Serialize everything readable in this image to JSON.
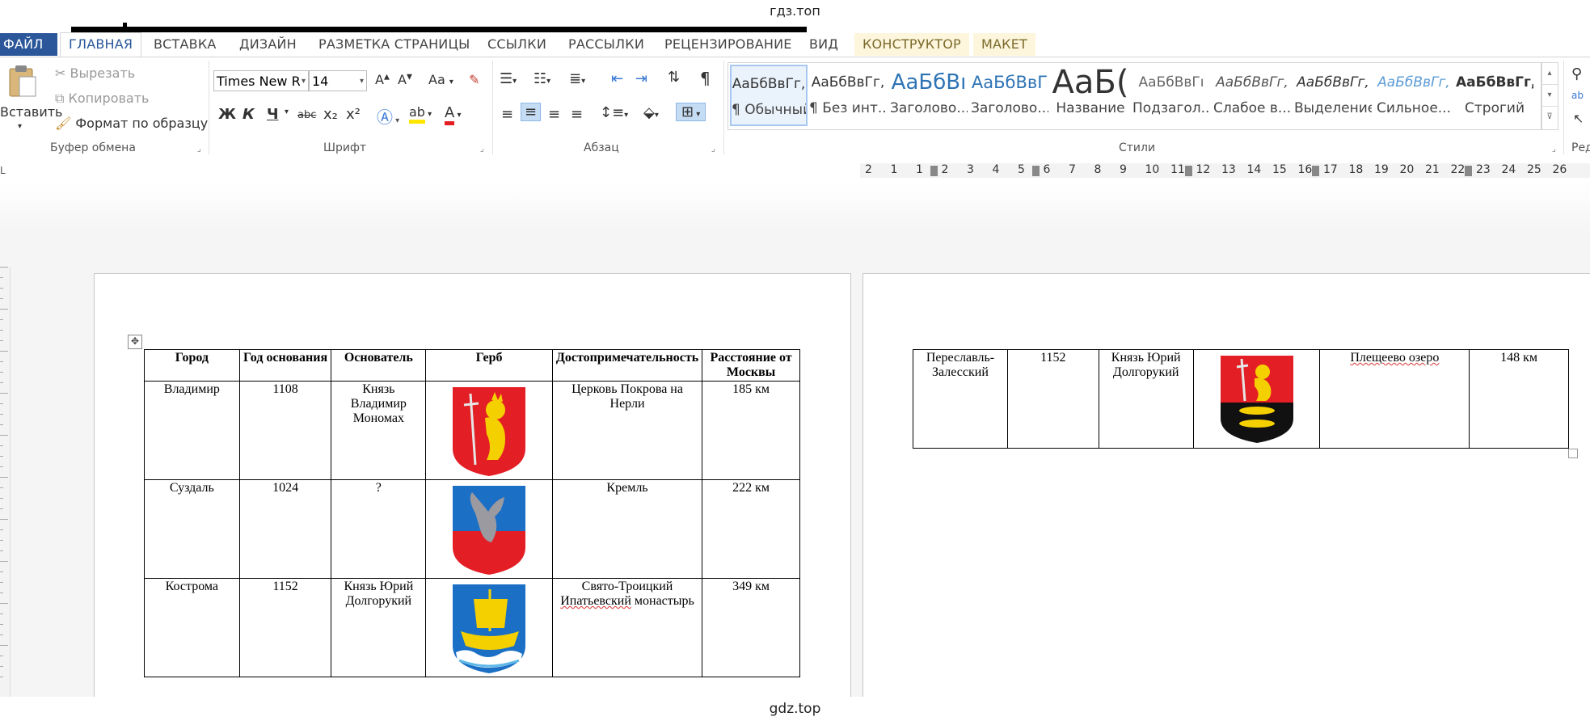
{
  "watermark": {
    "top": "гдз.топ",
    "bottom": "gdz.top"
  },
  "ribbon_tabs": [
    "ФАЙЛ",
    "ГЛАВНАЯ",
    "ВСТАВКА",
    "ДИЗАЙН",
    "РАЗМЕТКА СТРАНИЦЫ",
    "ССЫЛКИ",
    "РАССЫЛКИ",
    "РЕЦЕНЗИРОВАНИЕ",
    "ВИД",
    "КОНСТРУКТОР",
    "МАКЕТ"
  ],
  "clipboard": {
    "paste": "Вставить",
    "cut": "Вырезать",
    "copy": "Копировать",
    "format_painter": "Формат по образцу",
    "group": "Буфер обмена"
  },
  "font": {
    "name": "Times New R",
    "size": "14",
    "group": "Шрифт",
    "grow": "A",
    "shrink": "A",
    "case": "Aa",
    "bold": "Ж",
    "italic": "К",
    "underline": "Ч",
    "strike": "abc",
    "sub": "x₂",
    "sup": "x²"
  },
  "paragraph": {
    "group": "Абзац",
    "pilcrow": "¶"
  },
  "styles": {
    "group": "Стили",
    "items": [
      {
        "preview": "АаБбВвГг,",
        "name": "¶ Обычный"
      },
      {
        "preview": "АаБбВвГг,",
        "name": "¶ Без инт..."
      },
      {
        "preview": "АаБбВı",
        "name": "Заголово..."
      },
      {
        "preview": "АаБбВвГ",
        "name": "Заголово..."
      },
      {
        "preview": "АаБ(",
        "name": "Название"
      },
      {
        "preview": "АаБбВвГı",
        "name": "Подзагол..."
      },
      {
        "preview": "АаБбВвГг,",
        "name": "Слабое в..."
      },
      {
        "preview": "АаБбВвГг,",
        "name": "Выделение"
      },
      {
        "preview": "АаБбВвГг,",
        "name": "Сильное..."
      },
      {
        "preview": "АаБбВвГг,",
        "name": "Строгий"
      }
    ]
  },
  "editing": {
    "label": "Ред"
  },
  "ruler_numbers": [
    "2",
    "1",
    "1",
    "2",
    "3",
    "4",
    "5",
    "6",
    "7",
    "8",
    "9",
    "10",
    "11",
    "12",
    "13",
    "14",
    "15",
    "16",
    "17",
    "18",
    "19",
    "20",
    "21",
    "22",
    "23",
    "24",
    "25",
    "26"
  ],
  "table1": {
    "headers": [
      "Город",
      "Год основания",
      "Основатель",
      "Герб",
      "Достопримечательность",
      "Расстояние от Москвы"
    ],
    "rows": [
      {
        "city": "Владимир",
        "year": "1108",
        "founder": "Князь Владимир Мономах",
        "sight": "Церковь Покрова на Нерли",
        "dist": "185 км"
      },
      {
        "city": "Суздаль",
        "year": "1024",
        "founder": "?",
        "sight": "Кремль",
        "dist": "222 км"
      },
      {
        "city": "Кострома",
        "year": "1152",
        "founder": "Князь Юрий Долгорукий",
        "sight_a": "Свято-Троицкий",
        "sight_b": "Ипатьевский",
        "sight_c": " монастырь",
        "dist": "349 км"
      }
    ]
  },
  "table2": {
    "row": {
      "city": "Переславль-Залесский",
      "year": "1152",
      "founder": "Князь Юрий Долгорукий",
      "sight": "Плещеево озеро",
      "dist": "148 км"
    }
  },
  "colors": {
    "accent": "#2b579a",
    "shield_red": "#e31e24",
    "shield_gold": "#f5d000",
    "shield_blue": "#1b6fc4"
  }
}
